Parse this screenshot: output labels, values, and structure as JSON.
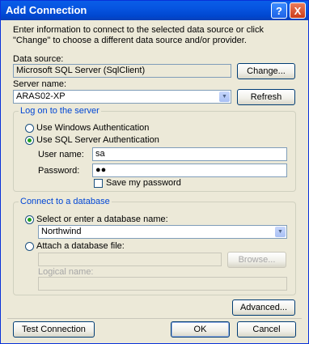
{
  "window": {
    "title": "Add Connection",
    "help_label": "?",
    "close_label": "X",
    "intro": "Enter information to connect to the selected data source or click \"Change\" to choose a different data source and/or provider."
  },
  "data_source": {
    "label": "Data source:",
    "value": "Microsoft SQL Server (SqlClient)",
    "change_button": "Change..."
  },
  "server": {
    "label": "Server name:",
    "value": "ARAS02-XP",
    "refresh_button": "Refresh"
  },
  "logon": {
    "group_title": "Log on to the server",
    "windows_auth": "Use Windows Authentication",
    "sql_auth": "Use SQL Server Authentication",
    "selected": "sql",
    "user_label": "User name:",
    "user_value": "sa",
    "password_label": "Password:",
    "password_value": "●●",
    "save_password": "Save my password",
    "save_password_checked": false
  },
  "database": {
    "group_title": "Connect to a database",
    "select_option": "Select or enter a database name:",
    "db_name": "Northwind",
    "attach_option": "Attach a database file:",
    "attach_value": "",
    "browse_button": "Browse...",
    "logical_label": "Logical name:",
    "logical_value": ""
  },
  "footer": {
    "advanced_button": "Advanced...",
    "test_button": "Test Connection",
    "ok_button": "OK",
    "cancel_button": "Cancel"
  }
}
